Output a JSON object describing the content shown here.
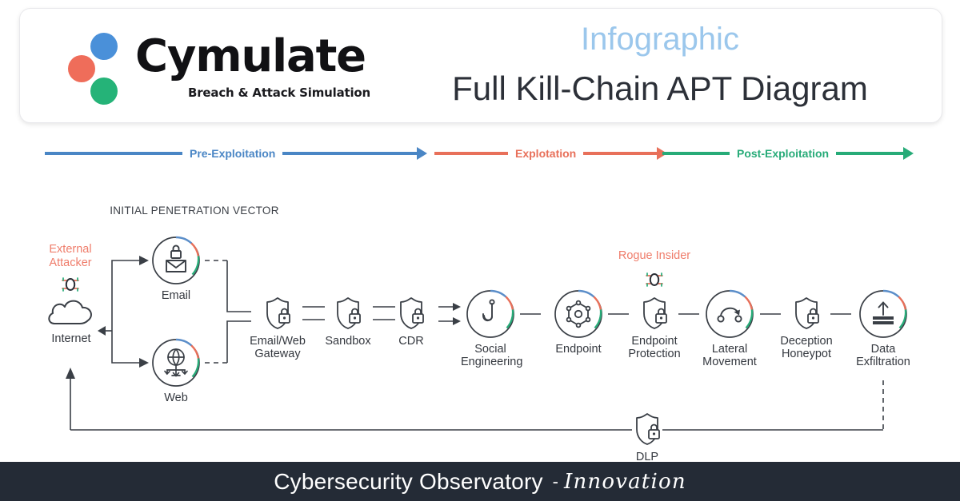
{
  "header": {
    "logo": {
      "wordmark": "Cymulate",
      "tagline": "Breach & Attack Simulation",
      "dot_blue": "#4a90d9",
      "dot_red": "#ef6d5a",
      "dot_green": "#25b378"
    },
    "kicker": "Infographic",
    "title": "Full Kill-Chain APT Diagram",
    "kicker_color": "#9bc7ec",
    "title_color": "#2c3038"
  },
  "phases": [
    {
      "label": "Pre-Exploitation",
      "color": "#4a86c5"
    },
    {
      "label": "Explotation",
      "color": "#e8705a"
    },
    {
      "label": "Post-Exploitation",
      "color": "#27ab78"
    }
  ],
  "diagram": {
    "section_label": "INITIAL PENETRATION\nVECTOR",
    "attacker_label": "External\nAttacker",
    "insider_label": "Rogue Insider",
    "accent_blue": "#5b8ec9",
    "accent_red": "#e8705a",
    "accent_green": "#27ab78",
    "line_color": "#3a3f46",
    "nodes": [
      {
        "id": "internet",
        "label": "Internet",
        "icon": "cloud-icon",
        "shape": "plain"
      },
      {
        "id": "email",
        "label": "Email",
        "icon": "email-lock-icon",
        "shape": "circle"
      },
      {
        "id": "web",
        "label": "Web",
        "icon": "globe-arrows-icon",
        "shape": "circle"
      },
      {
        "id": "email-web-gateway",
        "label": "Email/Web\nGateway",
        "icon": "shield-lock-icon",
        "shape": "shield"
      },
      {
        "id": "sandbox",
        "label": "Sandbox",
        "icon": "shield-lock-icon",
        "shape": "shield"
      },
      {
        "id": "cdr",
        "label": "CDR",
        "icon": "shield-lock-icon",
        "shape": "shield"
      },
      {
        "id": "social-engineering",
        "label": "Social\nEngineering",
        "icon": "fishhook-icon",
        "shape": "circle"
      },
      {
        "id": "endpoint",
        "label": "Endpoint",
        "icon": "hexagon-node-icon",
        "shape": "circle"
      },
      {
        "id": "endpoint-protection",
        "label": "Endpoint\nProtection",
        "icon": "shield-lock-icon",
        "shape": "shield"
      },
      {
        "id": "lateral-movement",
        "label": "Lateral\nMovement",
        "icon": "move-arrow-icon",
        "shape": "circle"
      },
      {
        "id": "deception-honeypot",
        "label": "Deception\nHoneypot",
        "icon": "shield-lock-icon",
        "shape": "shield"
      },
      {
        "id": "data-exfiltration",
        "label": "Data\nExfiltration",
        "icon": "upload-stack-icon",
        "shape": "circle"
      },
      {
        "id": "dlp",
        "label": "DLP",
        "icon": "shield-lock-icon",
        "shape": "shield"
      }
    ]
  },
  "footer": {
    "main": "Cybersecurity Observatory",
    "dash": "-",
    "script": "Innovation",
    "background": "#242b36"
  }
}
